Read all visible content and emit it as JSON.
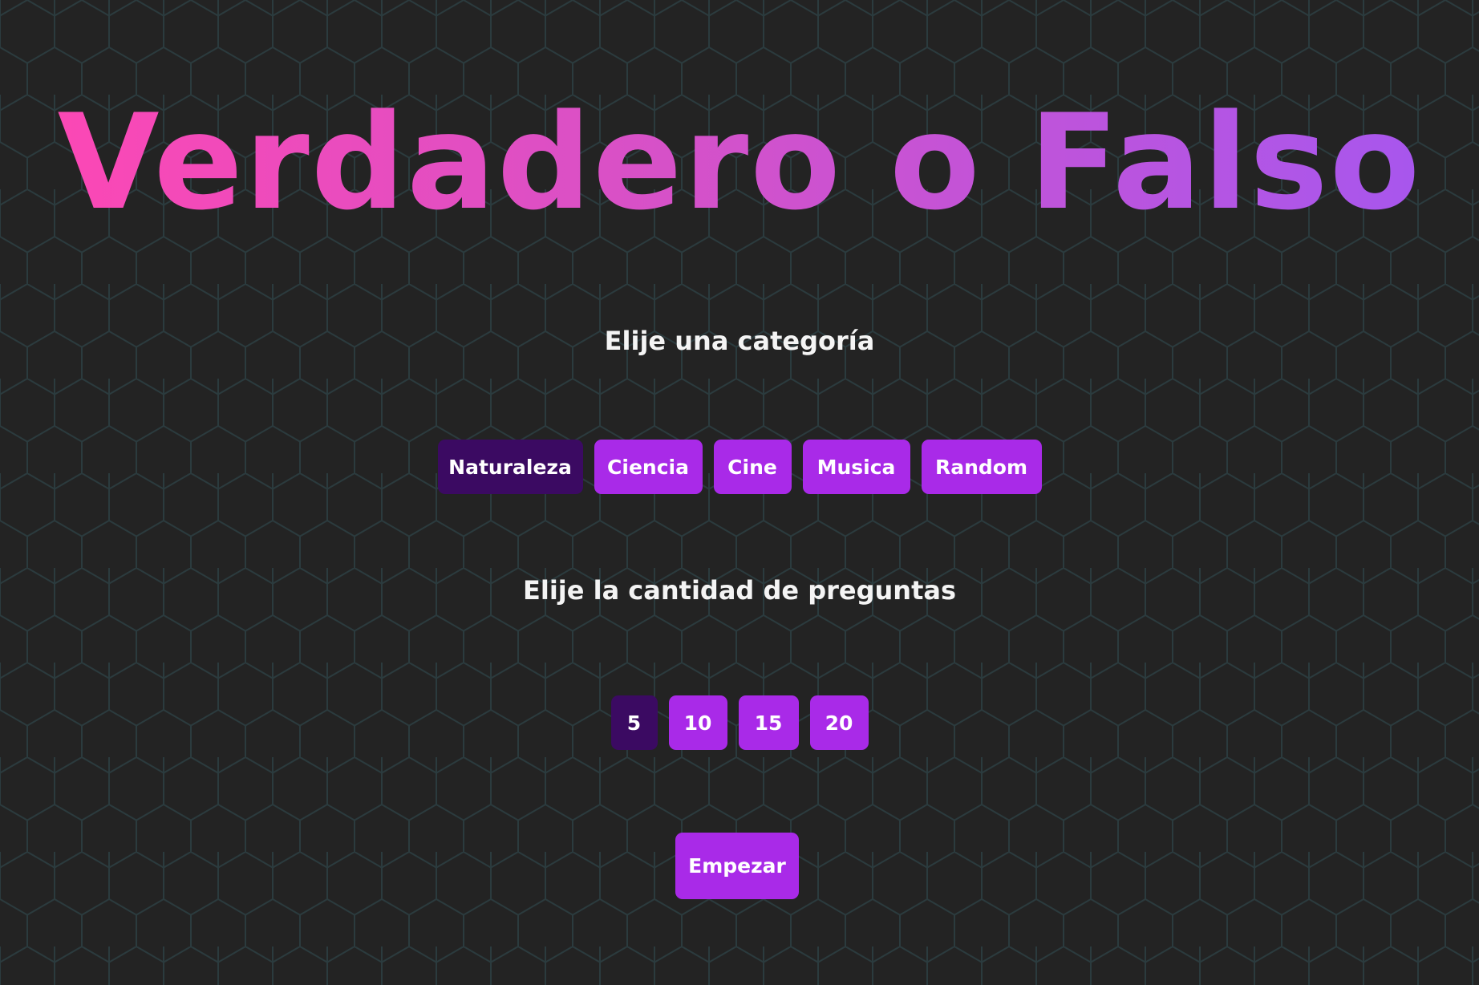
{
  "title": "Verdadero o Falso",
  "colors": {
    "background": "#232323",
    "hex_lines": "#2b3b3e",
    "button": "#a92ae8",
    "button_selected": "#3b0a62",
    "title_gradient_start": "#ff47b3",
    "title_gradient_end": "#a457f0"
  },
  "category_section": {
    "label": "Elije una categoría",
    "options": [
      {
        "label": "Naturaleza",
        "selected": true
      },
      {
        "label": "Ciencia",
        "selected": false
      },
      {
        "label": "Cine",
        "selected": false
      },
      {
        "label": "Musica",
        "selected": false
      },
      {
        "label": "Random",
        "selected": false
      }
    ]
  },
  "quantity_section": {
    "label": "Elije la cantidad de preguntas",
    "options": [
      {
        "label": "5",
        "selected": true
      },
      {
        "label": "10",
        "selected": false
      },
      {
        "label": "15",
        "selected": false
      },
      {
        "label": "20",
        "selected": false
      }
    ]
  },
  "start_button": {
    "label": "Empezar"
  }
}
